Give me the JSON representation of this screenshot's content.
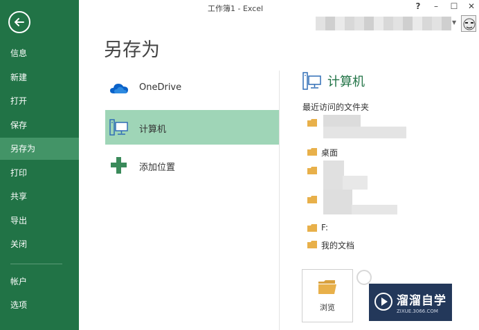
{
  "window": {
    "title": "工作簿1 - Excel",
    "help": "?",
    "minimize": "–",
    "maximize": "☐",
    "close": "✕"
  },
  "sidebar": {
    "items": [
      {
        "label": "信息"
      },
      {
        "label": "新建"
      },
      {
        "label": "打开"
      },
      {
        "label": "保存"
      },
      {
        "label": "另存为",
        "active": true
      },
      {
        "label": "打印"
      },
      {
        "label": "共享"
      },
      {
        "label": "导出"
      },
      {
        "label": "关闭"
      },
      {
        "label": "帐户"
      },
      {
        "label": "选项"
      }
    ]
  },
  "page": {
    "title": "另存为"
  },
  "locations": [
    {
      "label": "OneDrive",
      "icon": "cloud-icon"
    },
    {
      "label": "计算机",
      "icon": "computer-icon",
      "selected": true
    },
    {
      "label": "添加位置",
      "icon": "plus-icon"
    }
  ],
  "pane": {
    "title": "计算机",
    "recent_label": "最近访问的文件夹",
    "folders": [
      {
        "label": ""
      },
      {
        "label": "桌面"
      },
      {
        "label": ""
      },
      {
        "label": ""
      },
      {
        "label": "F:"
      },
      {
        "label": "我的文档"
      }
    ],
    "browse_label": "浏览"
  },
  "watermark": {
    "title": "溜溜自学",
    "url": "ZIXUE.3066.COM"
  },
  "colors": {
    "sidebar_bg": "#217346",
    "sidebar_active": "#439467",
    "selected_location": "#9fd5b7",
    "accent": "#217346",
    "folder": "#e8b04a"
  }
}
